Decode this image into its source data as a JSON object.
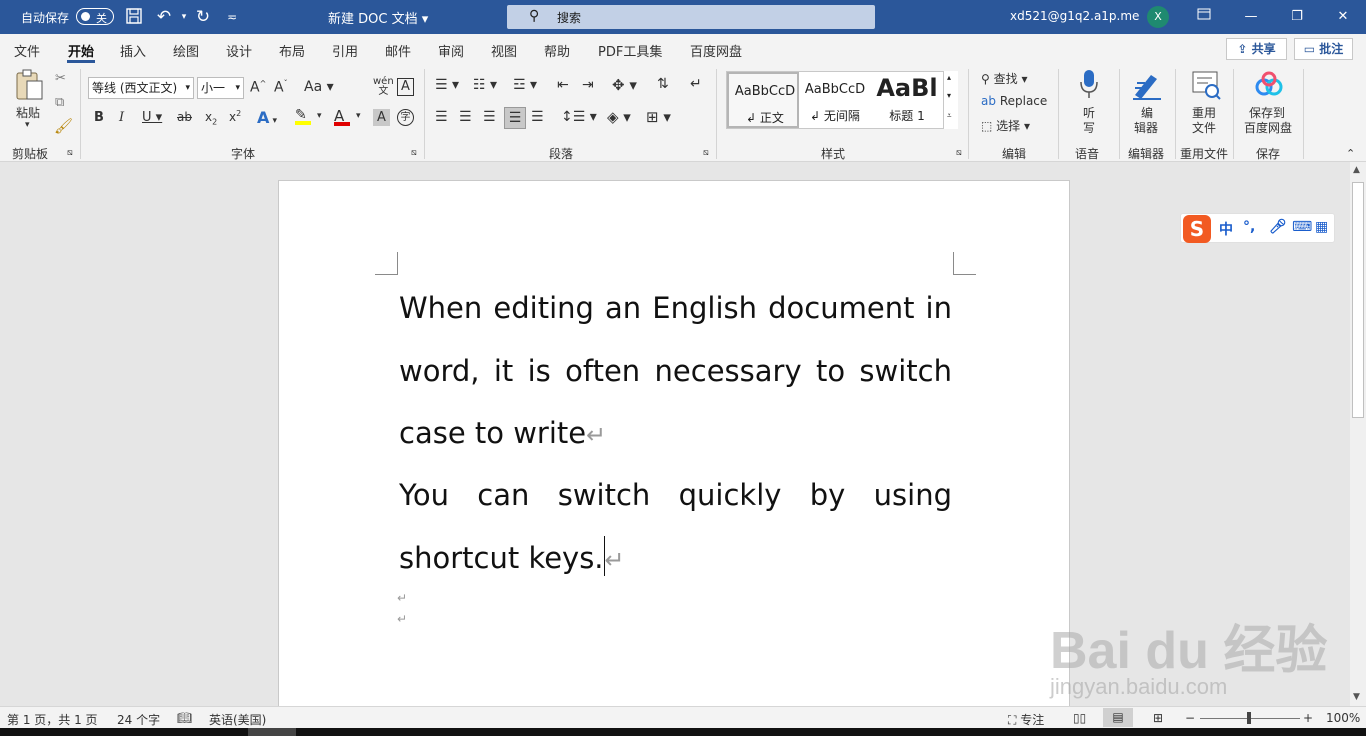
{
  "titlebar": {
    "autosave_label": "自动保存",
    "autosave_state": "关",
    "doc_title": "新建 DOC 文档",
    "search_label": "搜索",
    "account": "xd521@g1q2.a1p.me",
    "avatar_initial": "X"
  },
  "tabs": [
    "文件",
    "开始",
    "插入",
    "绘图",
    "设计",
    "布局",
    "引用",
    "邮件",
    "审阅",
    "视图",
    "帮助",
    "PDF工具集",
    "百度网盘"
  ],
  "active_tab": "开始",
  "actions": {
    "share": "共享",
    "comment": "批注"
  },
  "ribbon": {
    "clipboard": {
      "paste": "粘贴",
      "label": "剪贴板"
    },
    "font": {
      "font_name": "等线 (西文正文)",
      "font_size": "小一",
      "label": "字体",
      "bold": "B",
      "italic": "I",
      "underline": "U",
      "strike": "ab",
      "subscript": "x₂",
      "superscript": "x²",
      "grow": "A^",
      "shrink": "Aˇ",
      "case": "Aa",
      "phonetic": "wén",
      "border": "A"
    },
    "paragraph": {
      "label": "段落"
    },
    "styles": {
      "label": "样式",
      "items": [
        {
          "preview": "AaBbCcD",
          "name": "正文"
        },
        {
          "preview": "AaBbCcD",
          "name": "无间隔"
        },
        {
          "preview": "AaBl",
          "name": "标题 1"
        }
      ]
    },
    "editing": {
      "find": "查找",
      "replace": "Replace",
      "select": "选择",
      "label": "编辑"
    },
    "voice": {
      "dictate_1": "听",
      "dictate_2": "写",
      "label": "语音"
    },
    "editor": {
      "btn_1": "编",
      "btn_2": "辑器",
      "label": "编辑器"
    },
    "reuse": {
      "btn_1": "重用",
      "btn_2": "文件",
      "label": "重用文件"
    },
    "save": {
      "btn_1": "保存到",
      "btn_2": "百度网盘",
      "label": "保存"
    }
  },
  "document": {
    "paragraph_1": "When editing an English document in word, it is often necessary to switch case to write",
    "paragraph_2": "You can switch quickly by using shortcut keys."
  },
  "ime": {
    "logo": "S",
    "mode": "中",
    "punct": "°,"
  },
  "watermark": {
    "brand": "Bai du 经验",
    "url": "jingyan.baidu.com"
  },
  "status": {
    "page": "第 1 页，共 1 页",
    "words": "24 个字",
    "language": "英语(美国)",
    "focus": "专注",
    "zoom": "100%"
  }
}
